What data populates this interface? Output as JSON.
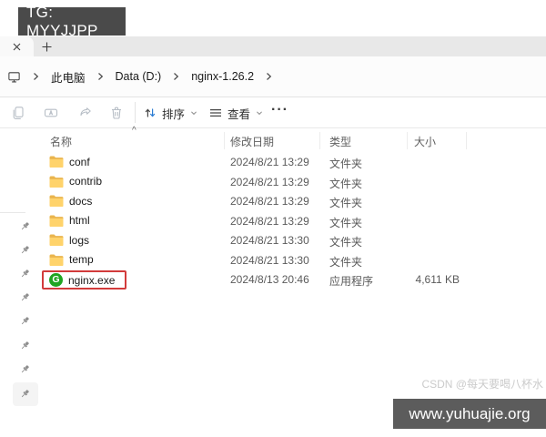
{
  "banner": {
    "text": "TG: MYYJJPP"
  },
  "tabs": {
    "close_glyph": "✕",
    "new_tab_glyph": "＋"
  },
  "breadcrumb": {
    "separator": "›",
    "items": [
      "此电脑",
      "Data (D:)",
      "nginx-1.26.2"
    ]
  },
  "toolbar": {
    "sort_label": "排序",
    "view_label": "查看",
    "more_glyph": "···",
    "icons": [
      "copy-icon",
      "rename-icon",
      "share-icon",
      "delete-icon",
      "sort-icon",
      "view-icon",
      "more-icon"
    ]
  },
  "list": {
    "columns": {
      "name": "名称",
      "date": "修改日期",
      "type": "类型",
      "size": "大小"
    },
    "sort_indicator": "^"
  },
  "files": [
    {
      "name": "conf",
      "date": "2024/8/21 13:29",
      "type": "文件夹",
      "size": "",
      "kind": "folder",
      "highlighted": false
    },
    {
      "name": "contrib",
      "date": "2024/8/21 13:29",
      "type": "文件夹",
      "size": "",
      "kind": "folder",
      "highlighted": false
    },
    {
      "name": "docs",
      "date": "2024/8/21 13:29",
      "type": "文件夹",
      "size": "",
      "kind": "folder",
      "highlighted": false
    },
    {
      "name": "html",
      "date": "2024/8/21 13:29",
      "type": "文件夹",
      "size": "",
      "kind": "folder",
      "highlighted": false
    },
    {
      "name": "logs",
      "date": "2024/8/21 13:30",
      "type": "文件夹",
      "size": "",
      "kind": "folder",
      "highlighted": false
    },
    {
      "name": "temp",
      "date": "2024/8/21 13:30",
      "type": "文件夹",
      "size": "",
      "kind": "folder",
      "highlighted": false
    },
    {
      "name": "nginx.exe",
      "date": "2024/8/13 20:46",
      "type": "应用程序",
      "size": "4,611 KB",
      "kind": "app",
      "highlighted": true
    }
  ],
  "nginx_icon_letter": "G",
  "watermark": {
    "csdn": "CSDN @每天要喝八杯水",
    "site": "www.yuhuajie.org"
  },
  "colors": {
    "highlight_red": "#d23b3b",
    "nginx_green": "#1fa421",
    "folder_yellow": "#ffd36b",
    "banner_bg": "#4a4a4a",
    "watermark_bg": "#5c5c5c",
    "sort_arrow_blue": "#2b7cd3"
  }
}
